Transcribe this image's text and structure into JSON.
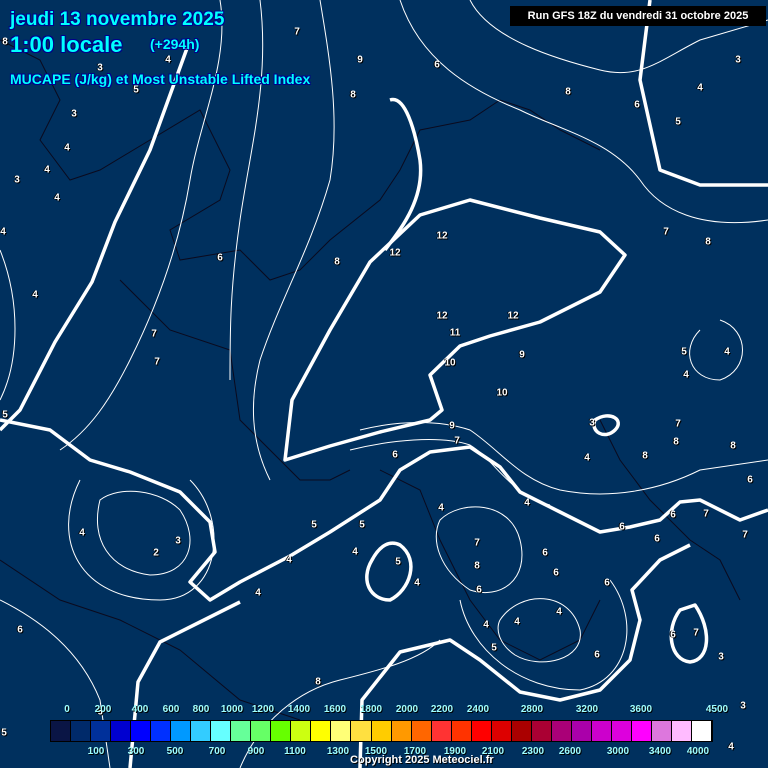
{
  "header": {
    "date": "jeudi 13 novembre 2025",
    "time": "1:00 locale",
    "lead": "(+294h)",
    "parameter": "MUCAPE (J/kg) et Most Unstable Lifted Index"
  },
  "run_info": "Run GFS 18Z du vendredi 31 octobre 2025",
  "copyright": "Copyright 2025 Meteociel.fr",
  "colorbar": {
    "colors": [
      "#0a1545",
      "#002a6a",
      "#00309a",
      "#0000d0",
      "#0000ff",
      "#0030ff",
      "#0099ff",
      "#33ccff",
      "#66ffff",
      "#66ff99",
      "#66ff66",
      "#66ff00",
      "#ccff11",
      "#ffff00",
      "#ffff77",
      "#ffe040",
      "#ffcc00",
      "#ff9900",
      "#ff6600",
      "#ff3333",
      "#ff3300",
      "#ff0000",
      "#dd0000",
      "#aa0000",
      "#aa0033",
      "#aa0077",
      "#aa00aa",
      "#cc00cc",
      "#dd00dd",
      "#ff00ff",
      "#dd77dd",
      "#ffbbff",
      "#ffffff"
    ],
    "top_labels": [
      "0",
      "200",
      "400",
      "600",
      "800",
      "1000",
      "1200",
      "1400",
      "1600",
      "1800",
      "2000",
      "2200",
      "2400",
      "2800",
      "3200",
      "3600",
      "4500"
    ],
    "bottom_labels": [
      "100",
      "300",
      "500",
      "700",
      "900",
      "1100",
      "1300",
      "1500",
      "1700",
      "1900",
      "2100",
      "2300",
      "2600",
      "3000",
      "3400",
      "4000"
    ]
  },
  "lifted_index_labels": [
    "8",
    "7",
    "9",
    "6",
    "8",
    "8",
    "6",
    "4",
    "5",
    "3",
    "3",
    "4",
    "5",
    "3",
    "4",
    "4",
    "4",
    "3",
    "4",
    "4",
    "6",
    "8",
    "12",
    "12",
    "12",
    "12",
    "11",
    "9",
    "10",
    "10",
    "9",
    "7",
    "6",
    "7",
    "7",
    "5",
    "4",
    "3",
    "2",
    "5",
    "5",
    "4",
    "5",
    "4",
    "4",
    "4",
    "4",
    "4",
    "7",
    "8",
    "6",
    "6",
    "6",
    "6",
    "6",
    "7",
    "7",
    "6",
    "6",
    "7",
    "3",
    "6",
    "4",
    "4",
    "4",
    "5",
    "6",
    "7",
    "8",
    "5",
    "4",
    "4",
    "7",
    "8",
    "8",
    "8",
    "3",
    "4",
    "6",
    "6",
    "8",
    "6",
    "5",
    "3",
    "4"
  ]
}
